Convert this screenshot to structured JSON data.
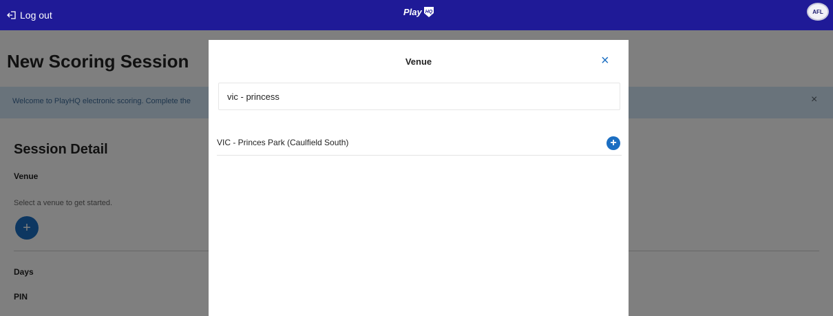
{
  "topbar": {
    "logout_label": "Log out",
    "brand_text": "Play",
    "brand_badge": "HQ",
    "afl_logo_text": "AFL"
  },
  "page": {
    "title": "New Scoring Session",
    "banner_text": "Welcome to PlayHQ electronic scoring. Complete the",
    "banner_close": "×",
    "section_title": "Session Detail",
    "venue_label": "Venue",
    "venue_hint": "Select a venue to get started.",
    "add_venue_symbol": "+",
    "days_label": "Days",
    "pin_label": "PIN"
  },
  "modal": {
    "title": "Venue",
    "close_symbol": "×",
    "search_value": "vic - princess",
    "results": [
      {
        "label": "VIC - Princes Park (Caulfield South)",
        "action_symbol": "+"
      }
    ]
  },
  "colors": {
    "topbar": "#1f1a97",
    "accent": "#1b6ec2",
    "banner": "#d3e6f6"
  }
}
